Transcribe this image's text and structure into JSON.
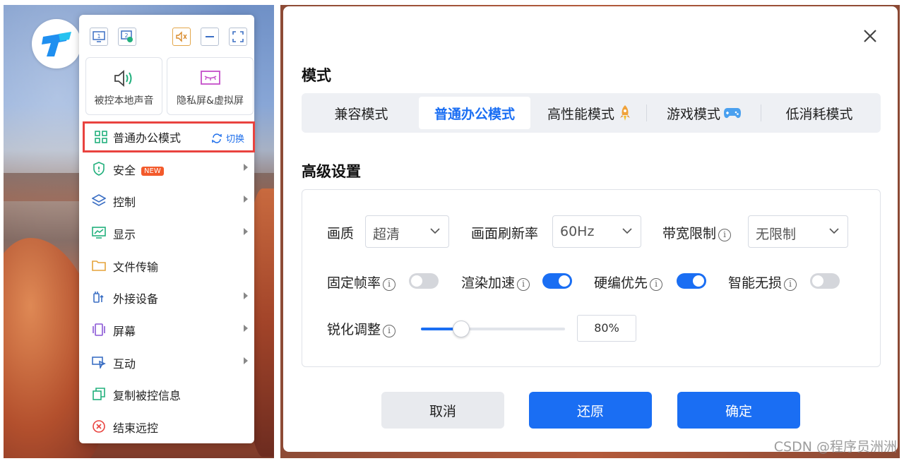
{
  "menu": {
    "toolbar_icons": [
      "monitor-1-icon",
      "monitor-2-icon",
      "mute-icon",
      "minimize-icon",
      "fullscreen-icon"
    ],
    "monitor1_label": "1",
    "monitor2_label": "2",
    "tiles": [
      {
        "label": "被控本地声音",
        "icon": "speaker-icon"
      },
      {
        "label": "隐私屏&虚拟屏",
        "icon": "privacy-screen-icon"
      }
    ],
    "current_mode": {
      "label": "普通办公模式",
      "switch_label": "切换"
    },
    "items": [
      {
        "label": "安全",
        "badge": "NEW",
        "icon": "shield-icon",
        "has_submenu": true
      },
      {
        "label": "控制",
        "icon": "layers-icon",
        "has_submenu": true
      },
      {
        "label": "显示",
        "icon": "chart-monitor-icon",
        "has_submenu": true
      },
      {
        "label": "文件传输",
        "icon": "folder-icon",
        "has_submenu": false
      },
      {
        "label": "外接设备",
        "icon": "usb-icon",
        "has_submenu": true
      },
      {
        "label": "屏幕",
        "icon": "screen-icon",
        "has_submenu": true
      },
      {
        "label": "互动",
        "icon": "interact-icon",
        "has_submenu": true
      },
      {
        "label": "复制被控信息",
        "icon": "copy-icon",
        "has_submenu": false
      },
      {
        "label": "结束远控",
        "icon": "end-icon",
        "has_submenu": false
      }
    ]
  },
  "dialog": {
    "mode_title": "模式",
    "tabs": [
      {
        "label": "兼容模式",
        "active": false
      },
      {
        "label": "普通办公模式",
        "active": true
      },
      {
        "label": "高性能模式",
        "active": false,
        "icon": "rocket-icon"
      },
      {
        "label": "游戏模式",
        "active": false,
        "icon": "gamepad-icon"
      },
      {
        "label": "低消耗模式",
        "active": false
      }
    ],
    "adv_title": "高级设置",
    "quality": {
      "label": "画质",
      "value": "超清"
    },
    "refresh": {
      "label": "画面刷新率",
      "value": "60Hz"
    },
    "bandwidth": {
      "label": "带宽限制",
      "value": "无限制"
    },
    "info_glyph": "i",
    "toggles": [
      {
        "label": "固定帧率",
        "on": false
      },
      {
        "label": "渲染加速",
        "on": true
      },
      {
        "label": "硬编优先",
        "on": true
      },
      {
        "label": "智能无损",
        "on": false
      }
    ],
    "sharpen": {
      "label": "锐化调整",
      "value": "80%",
      "fraction": 0.28
    },
    "buttons": {
      "cancel": "取消",
      "restore": "还原",
      "confirm": "确定"
    }
  },
  "colors": {
    "accent": "#1a6ef3",
    "highlight_border": "#e9433f",
    "badge": "#f35a2b"
  },
  "watermark": "CSDN @程序员洲洲"
}
